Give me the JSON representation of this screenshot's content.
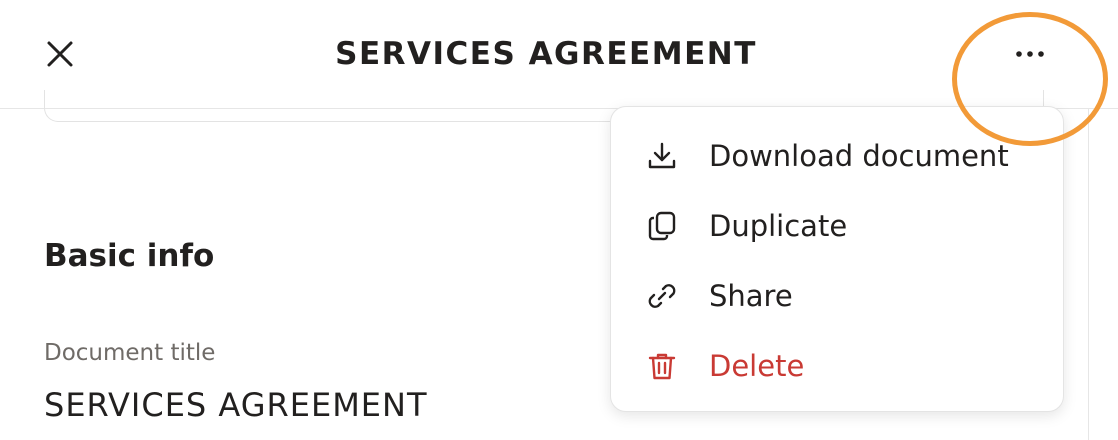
{
  "header": {
    "title": "SERVICES AGREEMENT",
    "close_icon": "close-icon",
    "more_icon": "more-horizontal-icon"
  },
  "main": {
    "section_heading": "Basic info",
    "document_title_label": "Document title",
    "document_title_value": "SERVICES AGREEMENT"
  },
  "menu": {
    "items": [
      {
        "label": "Download document",
        "icon": "download-icon"
      },
      {
        "label": "Duplicate",
        "icon": "duplicate-icon"
      },
      {
        "label": "Share",
        "icon": "link-icon"
      },
      {
        "label": "Delete",
        "icon": "trash-icon"
      }
    ]
  },
  "colors": {
    "text": "#22201f",
    "muted": "#6f6b67",
    "danger": "#c93a34",
    "highlight": "#f29a38",
    "border": "#e4e4e4"
  }
}
